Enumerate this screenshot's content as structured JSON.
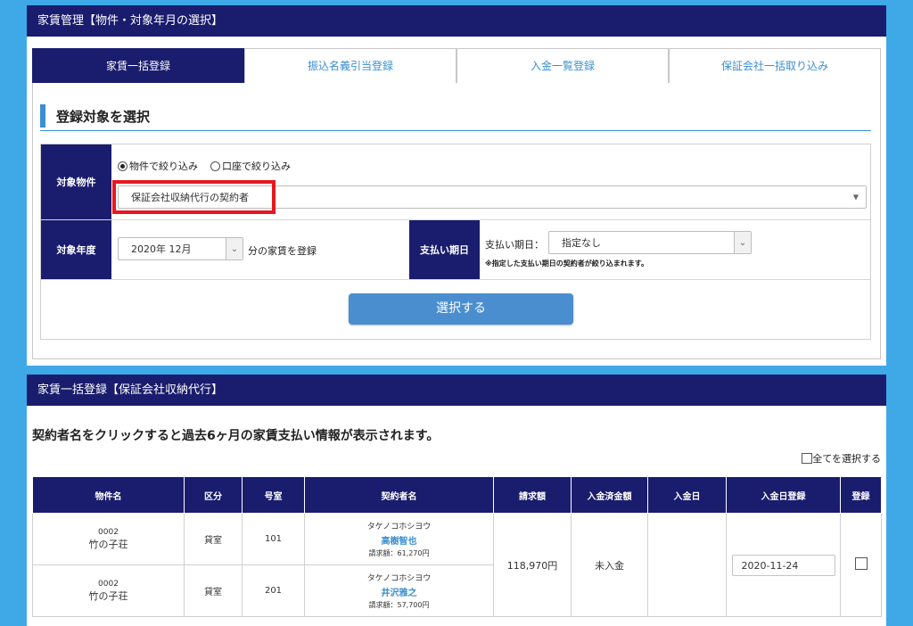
{
  "panel1": {
    "header": "家賃管理【物件・対象年月の選択】",
    "tabs": [
      {
        "label": "家賃一括登録",
        "active": true
      },
      {
        "label": "振込名義引当登録"
      },
      {
        "label": "入金一覧登録"
      },
      {
        "label": "保証会社一括取り込み"
      }
    ],
    "section_title": "登録対象を選択",
    "property_label": "対象物件",
    "radio_property": "物件で絞り込み",
    "radio_account": "口座で絞り込み",
    "property_select": "保証会社収納代行の契約者",
    "year_label": "対象年度",
    "year_select": "2020年 12月",
    "year_suffix": "分の家賃を登録",
    "due_label": "支払い期日",
    "due_field_label": "支払い期日：",
    "due_select": "指定なし",
    "due_note": "※指定した支払い期日の契約者が絞り込まれます。",
    "submit": "選択する"
  },
  "panel2": {
    "header": "家賃一括登録【保証会社収納代行】",
    "notice": "契約者名をクリックすると過去6ヶ月の家賃支払い情報が表示されます。",
    "select_all": "全てを選択する",
    "columns": [
      "物件名",
      "区分",
      "号室",
      "契約者名",
      "請求額",
      "入金済金額",
      "入金日",
      "入金日登録",
      "登録"
    ],
    "rows": [
      {
        "code": "0002",
        "property": "竹の子荘",
        "type": "貸室",
        "room": "101",
        "kana": "タケノコホシヨウ",
        "name": "高樹智也",
        "billed": "請求額：61,270円"
      },
      {
        "code": "0002",
        "property": "竹の子荘",
        "type": "貸室",
        "room": "201",
        "kana": "タケノコホシヨウ",
        "name": "井沢雅之",
        "billed": "請求額：57,700円"
      }
    ],
    "group": {
      "amount": "118,970円",
      "paid": "未入金",
      "date_value": "2020-11-24"
    }
  },
  "colors": {
    "navy": "#1a1c6e",
    "accent": "#3a8fd0",
    "background": "#3fa9e8",
    "highlight": "#e8171f"
  }
}
